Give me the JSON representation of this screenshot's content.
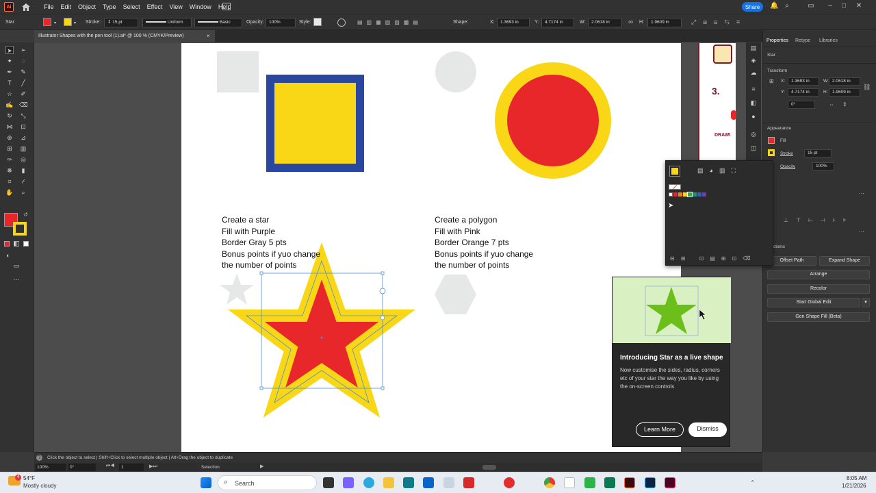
{
  "menubar": {
    "app_logo": "Ai",
    "items": [
      "File",
      "Edit",
      "Object",
      "Type",
      "Select",
      "Effect",
      "View",
      "Window",
      "Help"
    ],
    "share_label": "Share"
  },
  "control": {
    "object_type": "Star",
    "stroke_label": "Stroke:",
    "stroke_value": "15 pt",
    "profile": "Uniform",
    "brush": "Basic",
    "opacity_label": "Opacity:",
    "opacity_value": "100%",
    "style_label": "Style:",
    "shape_label": "Shape:",
    "x_label": "X:",
    "x_value": "1.3693 in",
    "y_label": "Y:",
    "y_value": "4.7174 in",
    "w_label": "W:",
    "w_value": "2.0618 in",
    "h_label": "H:",
    "h_value": "1.9609 in",
    "fill_color": "#e8262a",
    "stroke_color": "#f7d51a"
  },
  "doc_tab": {
    "title": "Illustrator Shapes with the pen tool (1).ai* @ 100 % (CMYK/Preview)",
    "close": "×"
  },
  "artboard": {
    "star_instructions": [
      "Create a star",
      "Fill with Purple",
      "Border Gray 5 pts",
      "Bonus points if yuo change",
      "the number of points"
    ],
    "polygon_instructions": [
      "Create a polygon",
      "Fill with Pink",
      "Border Orange 7 pts",
      "Bonus points if yuo change",
      "the number of points"
    ],
    "side_label_3": "3.",
    "side_label_drawing": "DRAWI"
  },
  "panel": {
    "tabs": [
      "Properties",
      "Retype",
      "Libraries"
    ],
    "object": "Star",
    "transform_title": "Transform",
    "x_label": "X:",
    "x_value": "1.3693 in",
    "y_label": "Y:",
    "y_value": "4.7174 in",
    "w_label": "W:",
    "w_value": "2.0618 in",
    "h_label": "H:",
    "h_value": "1.9609 in",
    "rotate_value": "0°",
    "appearance_title": "Appearance",
    "fill_label": "Fill",
    "stroke_label": "Stroke",
    "stroke_value": "15 pt",
    "opacity_label": "Opacity",
    "opacity_value": "100%",
    "quick_actions_title": "k Actions",
    "buttons": {
      "offset_path": "Offset Path",
      "expand_shape": "Expand Shape",
      "arrange": "Arrange",
      "recolor": "Recolor",
      "start_global_edit": "Start Global Edit",
      "gen_shape_fill": "Gen Shape Fill (Beta)"
    }
  },
  "swatches": [
    "#e8262a",
    "#f07d1e",
    "#f7d51a",
    "#3aa845",
    "#1f8f84",
    "#2b63b5",
    "#6e3ea6"
  ],
  "tooltip": {
    "title": "Introducing Star as a live shape",
    "body": "Now customise the sides, radius, corners etc of your star the way you like by using the on-screen controls",
    "learn_more": "Learn More",
    "dismiss": "Dismiss"
  },
  "status": {
    "hint": "Click the object to select  |  Shift+Click to select multiple object  |  Alt+Drag the object to duplicate",
    "zoom": "100%",
    "rotation": "0°",
    "artboard_num": "1",
    "mode": "Selection"
  },
  "taskbar": {
    "weather_temp": "54°F",
    "weather_desc": "Mostly cloudy",
    "weather_badge": "4",
    "search_placeholder": "Search",
    "time": "8:05 AM",
    "date": "1/21/2026"
  }
}
